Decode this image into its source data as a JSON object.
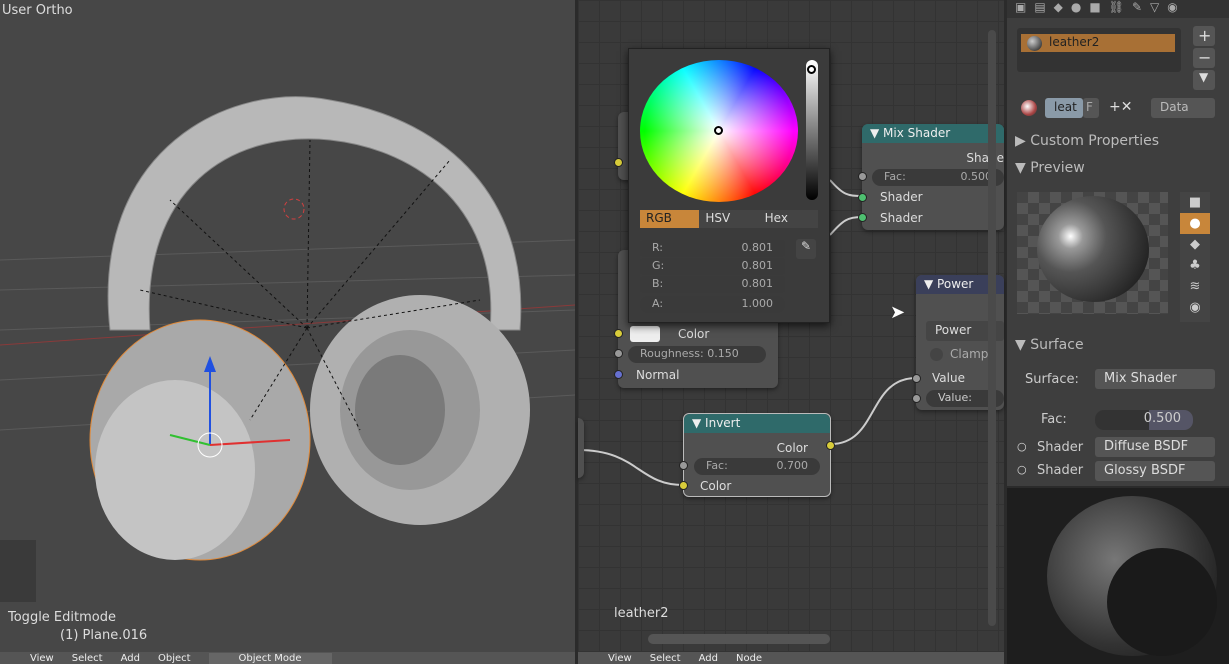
{
  "viewport": {
    "view_label": "User Ortho",
    "operator": "Toggle Editmode",
    "object": "(1) Plane.016",
    "menu": [
      "View",
      "Select",
      "Add",
      "Object"
    ],
    "mode": "Object Mode"
  },
  "node_editor": {
    "material_label": "leather2",
    "menu": [
      "View",
      "Select",
      "Add",
      "Node"
    ],
    "color_picker": {
      "tabs": [
        "RGB",
        "HSV",
        "Hex"
      ],
      "active_tab": "RGB",
      "fields": [
        {
          "label": "R:",
          "value": "0.801"
        },
        {
          "label": "G:",
          "value": "0.801"
        },
        {
          "label": "B:",
          "value": "0.801"
        },
        {
          "label": "A:",
          "value": "1.000"
        }
      ]
    },
    "diffuse_node": {
      "color": "Color",
      "roughness": "Roughness: 0.150",
      "normal": "Normal"
    },
    "mix_shader": {
      "title": "Mix Shader",
      "output": "Shade",
      "fac_label": "Fac:",
      "fac_value": "0.500",
      "in1": "Shader",
      "in2": "Shader"
    },
    "power": {
      "title": "Power",
      "op": "Power",
      "clamp": "Clamp",
      "output": "Value",
      "input": "Value:"
    },
    "invert": {
      "title": "Invert",
      "output": "Color",
      "fac_label": "Fac:",
      "fac_value": "0.700",
      "input": "Color"
    }
  },
  "properties": {
    "material_slot": "leather2",
    "datablock": "leat",
    "fake": "F",
    "link": "Data",
    "sections": {
      "custom": "Custom Properties",
      "preview": "Preview",
      "surface": "Surface"
    },
    "surface": {
      "surface_label": "Surface:",
      "surface_value": "Mix Shader",
      "fac_label": "Fac:",
      "fac_value": "0.500",
      "shader1_label": "Shader",
      "shader1_value": "Diffuse BSDF",
      "shader2_label": "Shader",
      "shader2_value": "Glossy BSDF"
    }
  },
  "colors": {
    "accent": "#c8863a",
    "node_header": "#2f6a6a"
  }
}
